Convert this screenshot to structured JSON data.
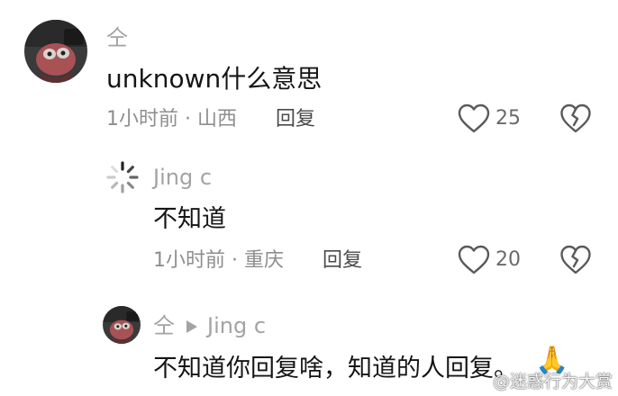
{
  "comment1": {
    "username": "仝",
    "text": "unknown什么意思",
    "meta": "1小时前 · 山西",
    "reply_label": "回复",
    "like_count": "25",
    "avatar_icon": "avatar-icon",
    "like_icon": "heart-outline-icon",
    "dislike_icon": "broken-heart-icon"
  },
  "comment2": {
    "username": "Jing c",
    "text": "不知道",
    "meta": "1小时前 · 重庆",
    "reply_label": "回复",
    "like_count": "20",
    "avatar_icon": "loading-spinner-avatar-icon",
    "like_icon": "heart-outline-icon",
    "dislike_icon": "broken-heart-icon"
  },
  "comment3": {
    "username": "仝",
    "reply_to": "Jing c",
    "text": "不知道你回复啥，知道的人回复。",
    "emoji": "🙏",
    "avatar_icon": "avatar-icon",
    "arrow_icon": "play-triangle-icon"
  },
  "watermark": {
    "text": "@迷惑行为大赏"
  },
  "colors": {
    "background": "#ffffff",
    "username": "#a3a3a3",
    "body_text": "#151515",
    "meta": "#8e8e8e",
    "icon": "#555555"
  }
}
